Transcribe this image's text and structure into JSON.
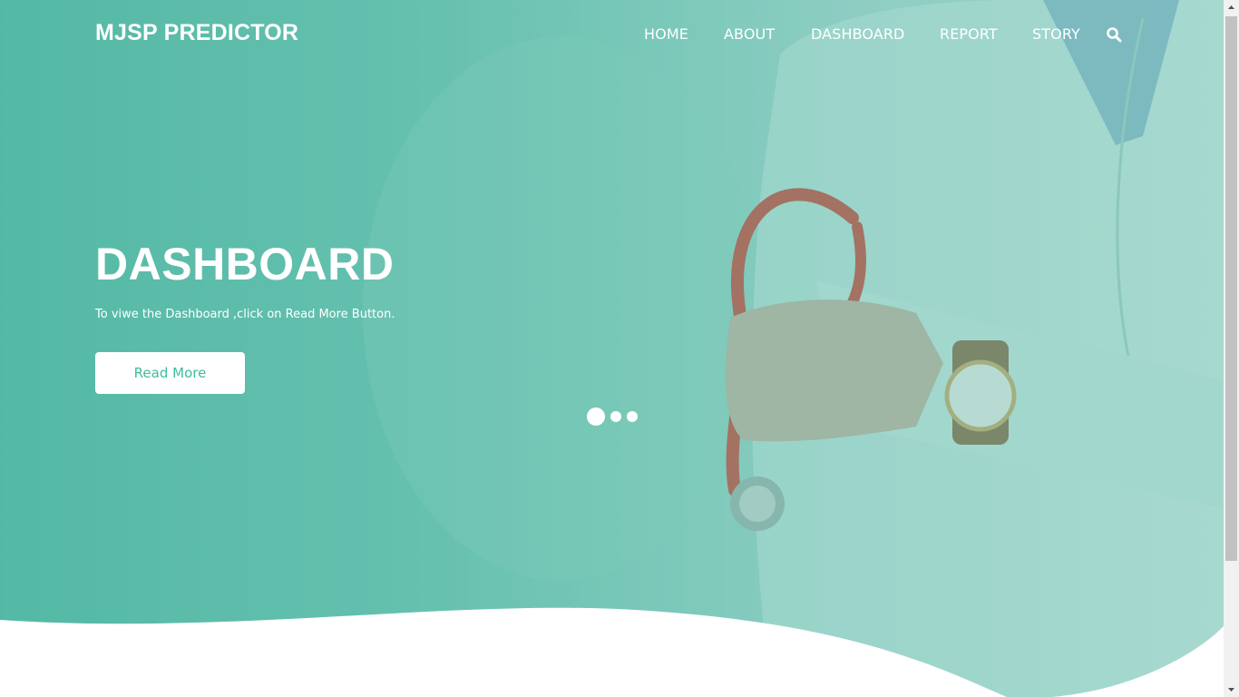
{
  "navbar": {
    "brand": "MJSP PREDICTOR",
    "links": [
      {
        "label": "HOME"
      },
      {
        "label": "ABOUT"
      },
      {
        "label": "DASHBOARD"
      },
      {
        "label": "REPORT"
      },
      {
        "label": "STORY"
      }
    ],
    "search_icon": "search-icon"
  },
  "hero": {
    "title": "DASHBOARD",
    "subtitle": "To viwe the Dashboard ,click on Read More Button.",
    "button_label": "Read More",
    "slide_count": 3,
    "active_slide": 1
  },
  "colors": {
    "accent": "#3fbd9c",
    "overlay": "#5bbca9",
    "text": "#ffffff"
  }
}
